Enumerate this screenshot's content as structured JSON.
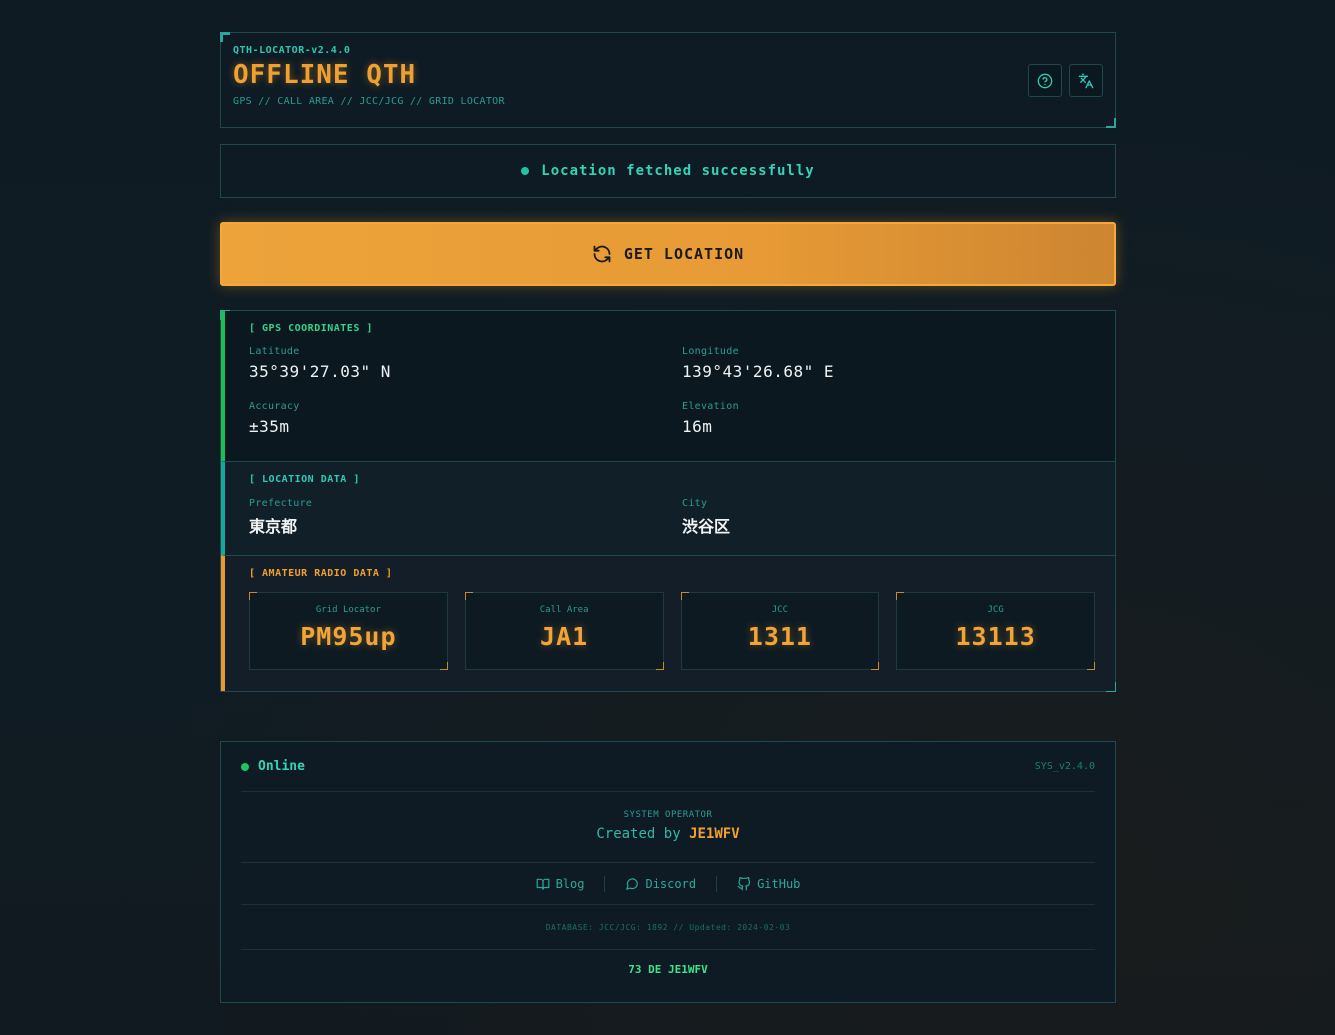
{
  "header": {
    "version": "QTH-LOCATOR-v2.4.0",
    "title": "OFFLINE QTH",
    "subtitle": "GPS // CALL AREA // JCC/JCG // GRID LOCATOR",
    "help_icon": "help-circle-icon",
    "lang_icon": "translate-icon"
  },
  "status": {
    "text": "Location fetched successfully"
  },
  "get_location": {
    "label": "GET LOCATION",
    "icon": "refresh-icon"
  },
  "gps": {
    "title": "[ GPS COORDINATES ]",
    "latitude_label": "Latitude",
    "latitude": "35°39'27.03\" N",
    "longitude_label": "Longitude",
    "longitude": "139°43'26.68\" E",
    "accuracy_label": "Accuracy",
    "accuracy": "±35m",
    "elevation_label": "Elevation",
    "elevation": "16m"
  },
  "location": {
    "title": "[ LOCATION DATA ]",
    "prefecture_label": "Prefecture",
    "prefecture": "東京都",
    "city_label": "City",
    "city": "渋谷区"
  },
  "radio": {
    "title": "[ AMATEUR RADIO DATA ]",
    "cards": [
      {
        "label": "Grid Locator",
        "value": "PM95up"
      },
      {
        "label": "Call Area",
        "value": "JA1"
      },
      {
        "label": "JCC",
        "value": "1311"
      },
      {
        "label": "JCG",
        "value": "13113"
      }
    ]
  },
  "footer": {
    "online": "Online",
    "sys_version": "SYS_v2.4.0",
    "operator_label": "SYSTEM OPERATOR",
    "created_by": "Created by",
    "operator_name": "JE1WFV",
    "links": [
      {
        "label": "Blog",
        "icon": "book-icon"
      },
      {
        "label": "Discord",
        "icon": "chat-bubble-icon"
      },
      {
        "label": "GitHub",
        "icon": "github-icon"
      }
    ],
    "database": "DATABASE: JCC/JCG: 1892 // Updated: 2024-02-03",
    "signoff": "73 DE JE1WFV"
  },
  "colors": {
    "accent_orange": "#f0a030",
    "accent_teal": "#2fcab6",
    "accent_green": "#1dbd55",
    "background": "#0f1a22"
  }
}
